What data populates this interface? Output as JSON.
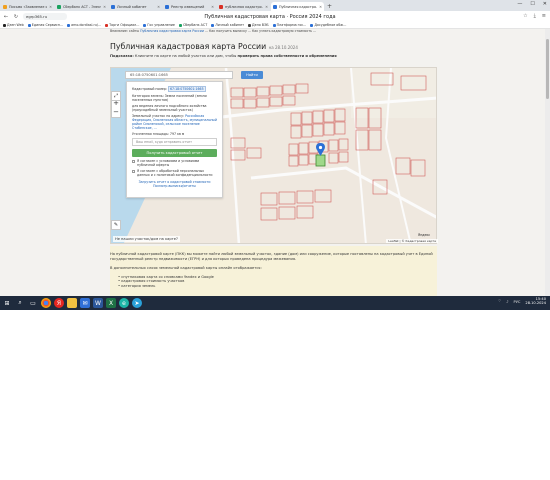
{
  "browser": {
    "window_title": "Публичная кадастровая карта · Россия 2024 года",
    "tabs": [
      {
        "label": "Письмо «Заявление об...",
        "color": "#f0a020",
        "active": false
      },
      {
        "label": "Сбербанк АСТ - Электр...",
        "color": "#1aa260",
        "active": false
      },
      {
        "label": "Личный кабинет",
        "color": "#2b6fd6",
        "active": false
      },
      {
        "label": "Реестр извещений",
        "color": "#2b6fd6",
        "active": false
      },
      {
        "label": "публичная кадастро...",
        "color": "#d93025",
        "active": false
      },
      {
        "label": "Публичная кадастро...",
        "color": "#2b6fd6",
        "active": true
      }
    ],
    "new_tab": "+",
    "url": "egrp365.ru",
    "page_title": "Публичная кадастровая карта · Россия 2024 года",
    "bookmarks": [
      {
        "label": "Дзен Web",
        "color": "#222222"
      },
      {
        "label": "Единая Сервисн...",
        "color": "#2b6fd6"
      },
      {
        "label": "amo.dordiasl.ru/...",
        "color": "#2b6fd6"
      },
      {
        "label": "Торги Официал...",
        "color": "#d93025"
      },
      {
        "label": "Гос управление",
        "color": "#2b6fd6"
      },
      {
        "label": "Сбербанк АСТ",
        "color": "#1aa260"
      },
      {
        "label": "Личный кабинет",
        "color": "#2b6fd6"
      },
      {
        "label": "Дело ВЭБ",
        "color": "#444444"
      },
      {
        "label": "Платформа гос...",
        "color": "#2b6fd6"
      },
      {
        "label": "Досудебное обж...",
        "color": "#2b6fd6"
      }
    ]
  },
  "page": {
    "info_line_a": "Внимание: сайты ",
    "info_line_link": "Публичная кадастровая карта России",
    "info_line_b": " ... Как получить выписку ... Как узнать кадастровую стоимость ...",
    "heading": "Публичная кадастровая карта России",
    "heading_date": "на 28.10.2024",
    "hint_label": "Подсказка:",
    "hint_text": " Кликните на карте на любой участок или дом, чтобы ",
    "hint_bold": "проверить права собственности и обременения",
    "search_value": "65:18:0750601:1665",
    "find_button": "Найти",
    "zoom_in": "+",
    "zoom_out": "−",
    "wrong_location": "Не нашли участок/дом на карте?",
    "map_copyright": "Leaflet | © Кадастровая карта",
    "map_footer": "Яндекс",
    "panel": {
      "cadnum_label": "Кадастровый номер:",
      "cadnum_value": "67:18:0750601:1665",
      "category": "Категория земель: Земли поселений (земли населенных пунктов)",
      "purpose": "для ведения личного подсобного хозяйства (приусадебный земельный участок)",
      "address_label": "Земельный участок по адресу:",
      "address": "Российская Федерация, Смоленская область, муниципальный район Смоленский, сельское поселение Стабенское, ...",
      "area": "Уточненная площадь: 797 кв м",
      "email_placeholder": "Ваш email, куда отправить отчет",
      "get_button": "Получить кадастровый отчет",
      "check1": "Я согласен с условиями и условиями публичной оферты",
      "check2": "Я согласен с обработкой персональных данных и с политикой конфиденциальности",
      "footer_link": "Загрузить отчет о кадастровой стоимости Посмотр.выписки/отчеты"
    },
    "text_p1": "На публичной кадастровой карте (ПКК) вы можете найти любой земельный участок, здание (дом) или сооружение, которые поставлены на кадастровый учет в Единой государственный реестр недвижимости (ЕГРН) и для которых проведена процедура межевания.",
    "text_p2": "В дополнительных слоях земельной кадастровой карты онлайн отображается:",
    "list": [
      "спутниковая карта со снимками Yandex и Google",
      "кадастровая стоимость участков",
      "категория земель"
    ]
  },
  "taskbar": {
    "time": "15:40",
    "date": "28.10.2024",
    "lang": "РУС"
  }
}
